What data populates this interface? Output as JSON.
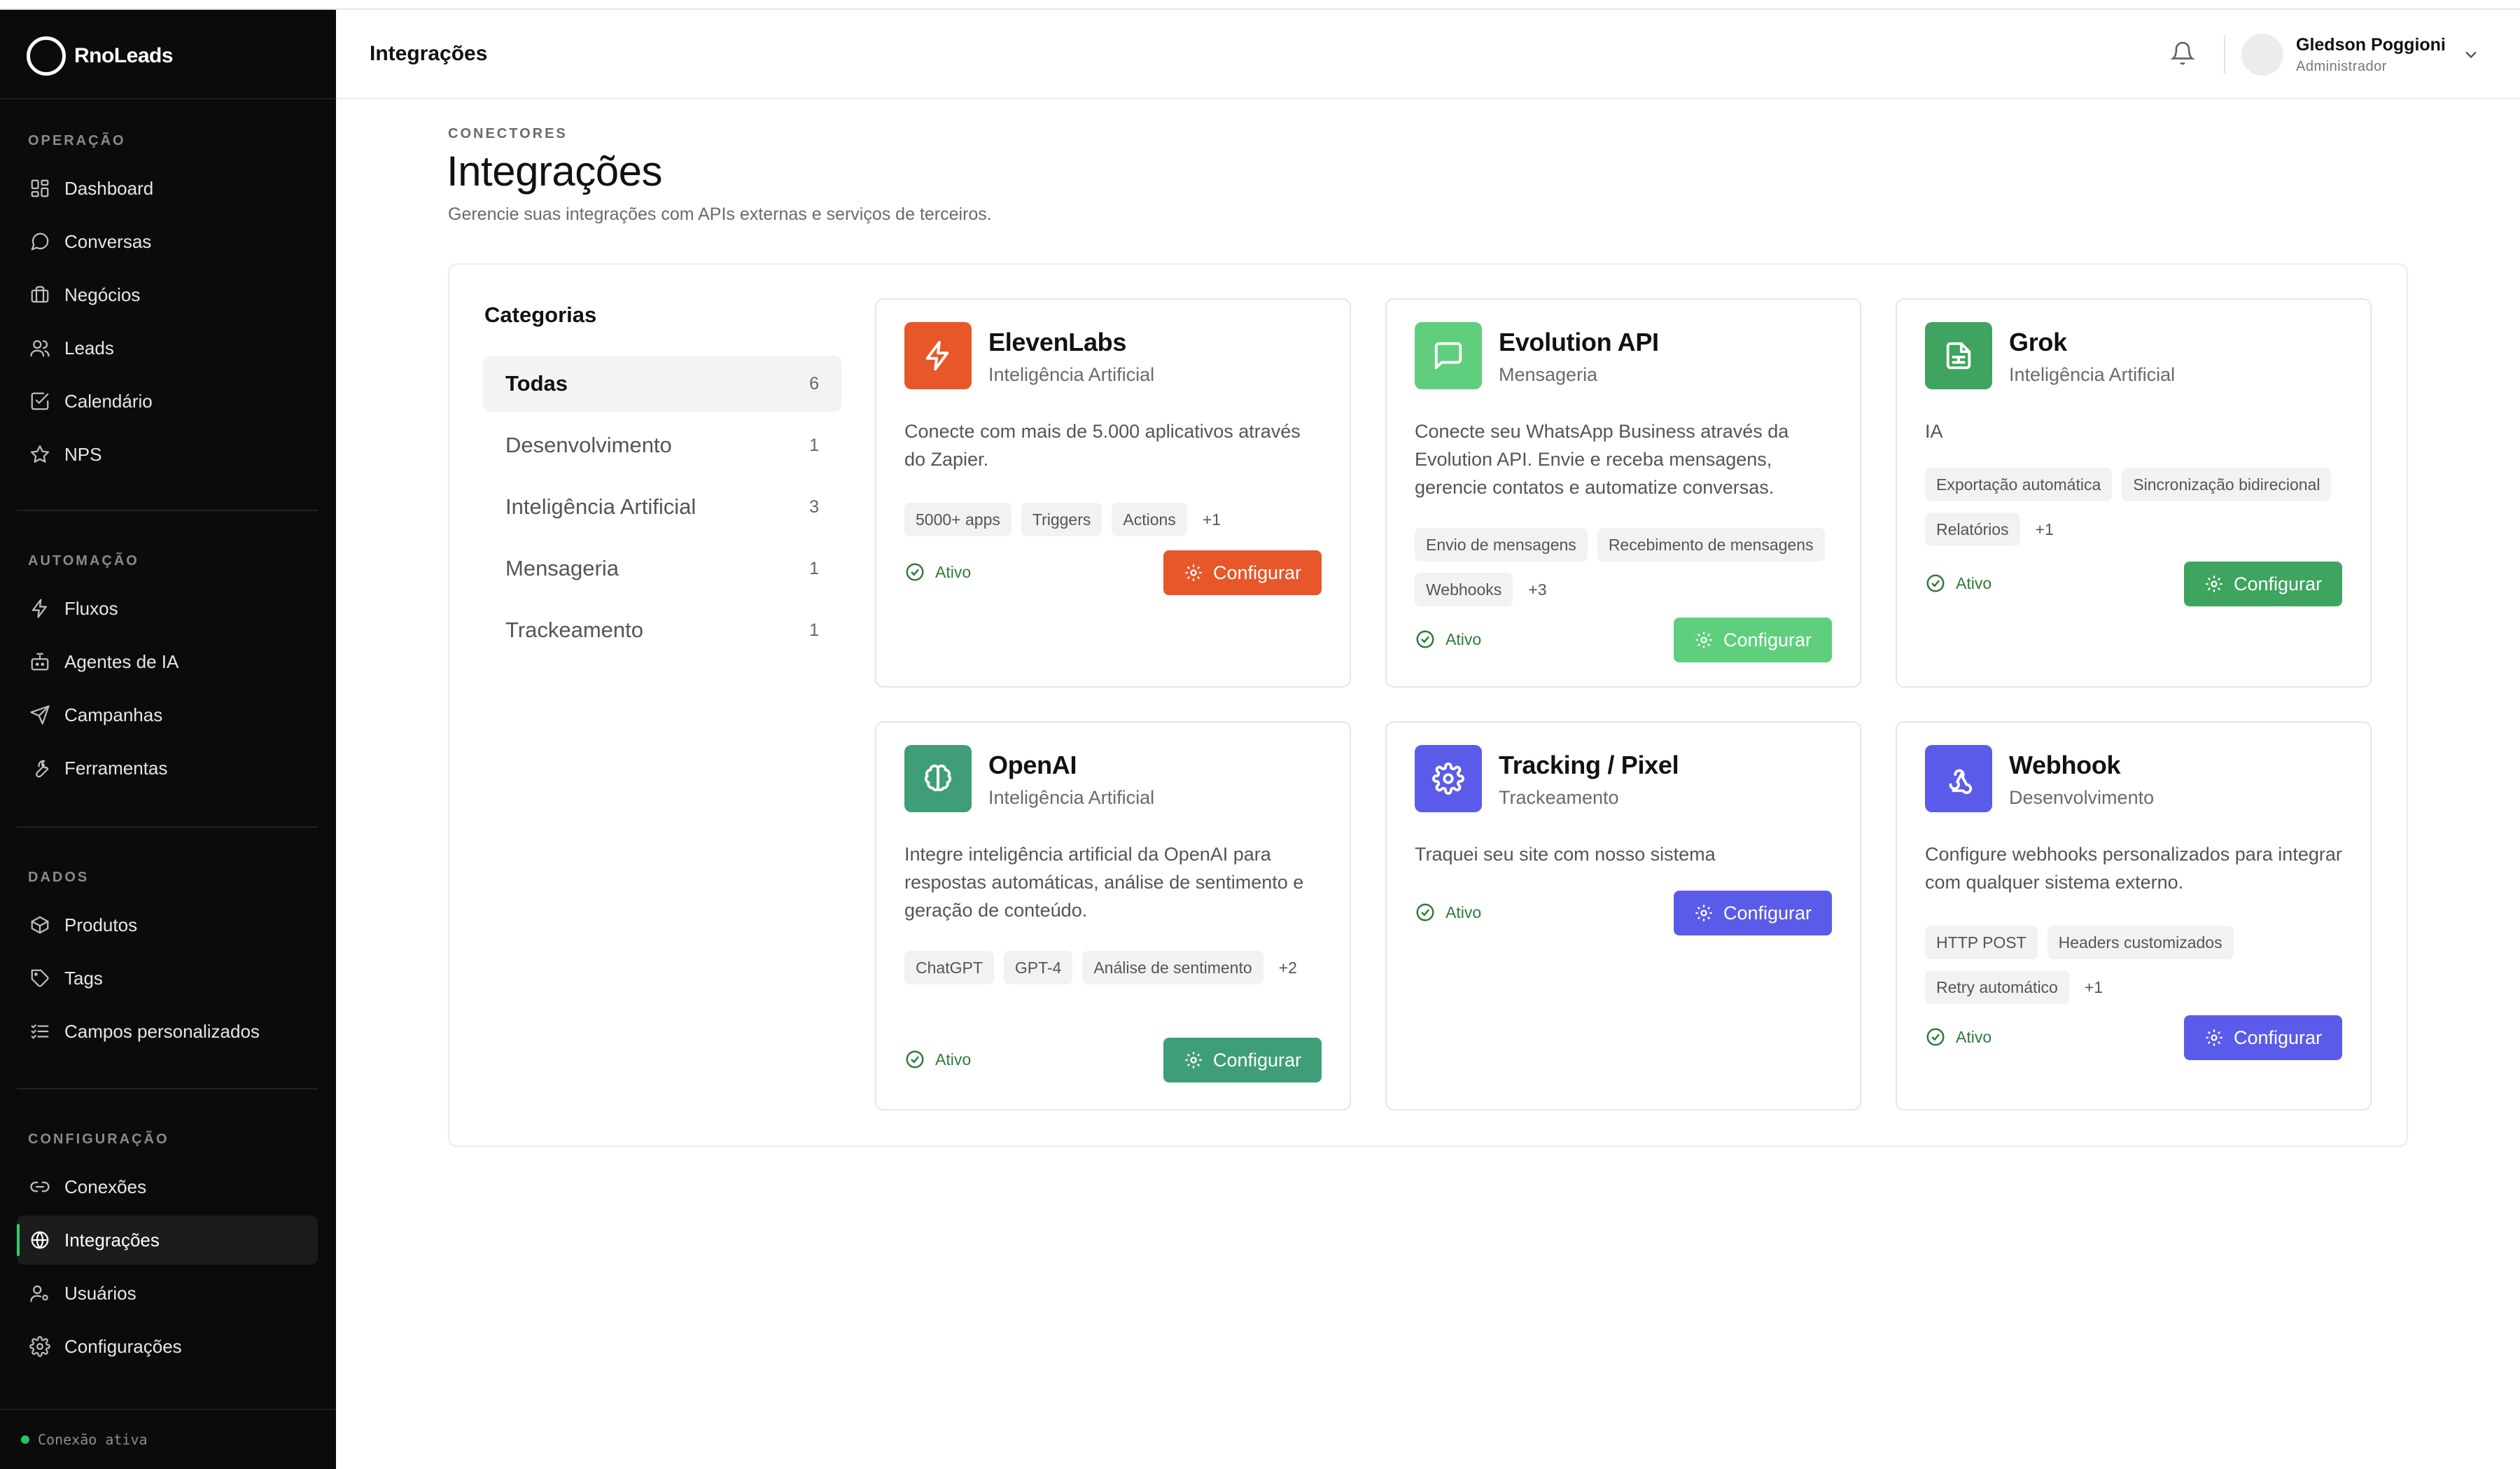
{
  "brand": {
    "name": "RnoLeads"
  },
  "sidebar": {
    "sections": [
      {
        "title": "OPERAÇÃO",
        "items": [
          {
            "label": "Dashboard",
            "icon": "grid-icon"
          },
          {
            "label": "Conversas",
            "icon": "chat-icon"
          },
          {
            "label": "Negócios",
            "icon": "briefcase-icon"
          },
          {
            "label": "Leads",
            "icon": "users-icon"
          },
          {
            "label": "Calendário",
            "icon": "calendar-check-icon"
          },
          {
            "label": "NPS",
            "icon": "star-icon"
          }
        ]
      },
      {
        "title": "AUTOMAÇÃO",
        "items": [
          {
            "label": "Fluxos",
            "icon": "lightning-icon"
          },
          {
            "label": "Agentes de IA",
            "icon": "bot-icon"
          },
          {
            "label": "Campanhas",
            "icon": "send-icon"
          },
          {
            "label": "Ferramentas",
            "icon": "wrench-icon"
          }
        ]
      },
      {
        "title": "DADOS",
        "items": [
          {
            "label": "Produtos",
            "icon": "package-icon"
          },
          {
            "label": "Tags",
            "icon": "tag-icon"
          },
          {
            "label": "Campos personalizados",
            "icon": "list-check-icon"
          }
        ]
      },
      {
        "title": "CONFIGURAÇÃO",
        "items": [
          {
            "label": "Conexões",
            "icon": "link-icon"
          },
          {
            "label": "Integrações",
            "icon": "globe-icon",
            "active": true
          },
          {
            "label": "Usuários",
            "icon": "user-cog-icon"
          },
          {
            "label": "Configurações",
            "icon": "gear-icon"
          }
        ]
      }
    ],
    "connection_status": "Conexão ativa"
  },
  "header": {
    "title": "Integrações",
    "user_name": "Gledson Poggioni",
    "user_role": "Administrador"
  },
  "page": {
    "eyebrow": "CONECTORES",
    "title": "Integrações",
    "subtitle": "Gerencie suas integrações com APIs externas e serviços de terceiros."
  },
  "categories": {
    "title": "Categorias",
    "items": [
      {
        "label": "Todas",
        "count": "6",
        "active": true
      },
      {
        "label": "Desenvolvimento",
        "count": "1"
      },
      {
        "label": "Inteligência Artificial",
        "count": "3"
      },
      {
        "label": "Mensageria",
        "count": "1"
      },
      {
        "label": "Trackeamento",
        "count": "1"
      }
    ]
  },
  "cards": [
    {
      "name": "ElevenLabs",
      "category": "Inteligência Artificial",
      "description": "Conecte com mais de 5.000 aplicativos através do Zapier.",
      "tags": [
        "5000+ apps",
        "Triggers",
        "Actions"
      ],
      "more": "+1",
      "status": "Ativo",
      "button": "Configurar",
      "color": "#e8572a",
      "icon": "lightning-icon"
    },
    {
      "name": "Evolution API",
      "category": "Mensageria",
      "description": "Conecte seu WhatsApp Business através da Evolution API. Envie e receba mensagens, gerencie contatos e automatize conversas.",
      "tags": [
        "Envio de mensagens",
        "Recebimento de mensagens",
        "Webhooks"
      ],
      "more": "+3",
      "status": "Ativo",
      "button": "Configurar",
      "color": "#5fcf7e",
      "icon": "message-square-icon"
    },
    {
      "name": "Grok",
      "category": "Inteligência Artificial",
      "description": "IA",
      "tags": [
        "Exportação automática",
        "Sincronização bidirecional",
        "Relatórios"
      ],
      "more": "+1",
      "status": "Ativo",
      "button": "Configurar",
      "color": "#3fa45f",
      "icon": "file-sheet-icon"
    },
    {
      "name": "OpenAI",
      "category": "Inteligência Artificial",
      "description": "Integre inteligência artificial da OpenAI para respostas automáticas, análise de sentimento e geração de conteúdo.",
      "tags": [
        "ChatGPT",
        "GPT-4",
        "Análise de sentimento"
      ],
      "more": "+2",
      "status": "Ativo",
      "button": "Configurar",
      "color": "#3f9e78",
      "icon": "brain-icon"
    },
    {
      "name": "Tracking / Pixel",
      "category": "Trackeamento",
      "description": "Traquei seu site com nosso sistema",
      "tags": [],
      "more": "",
      "status": "Ativo",
      "button": "Configurar",
      "color": "#5b5bea",
      "icon": "gear-icon"
    },
    {
      "name": "Webhook",
      "category": "Desenvolvimento",
      "description": "Configure webhooks personalizados para integrar com qualquer sistema externo.",
      "tags": [
        "HTTP POST",
        "Headers customizados",
        "Retry automático"
      ],
      "more": "+1",
      "status": "Ativo",
      "button": "Configurar",
      "color": "#5b5bea",
      "icon": "webhook-icon"
    }
  ]
}
